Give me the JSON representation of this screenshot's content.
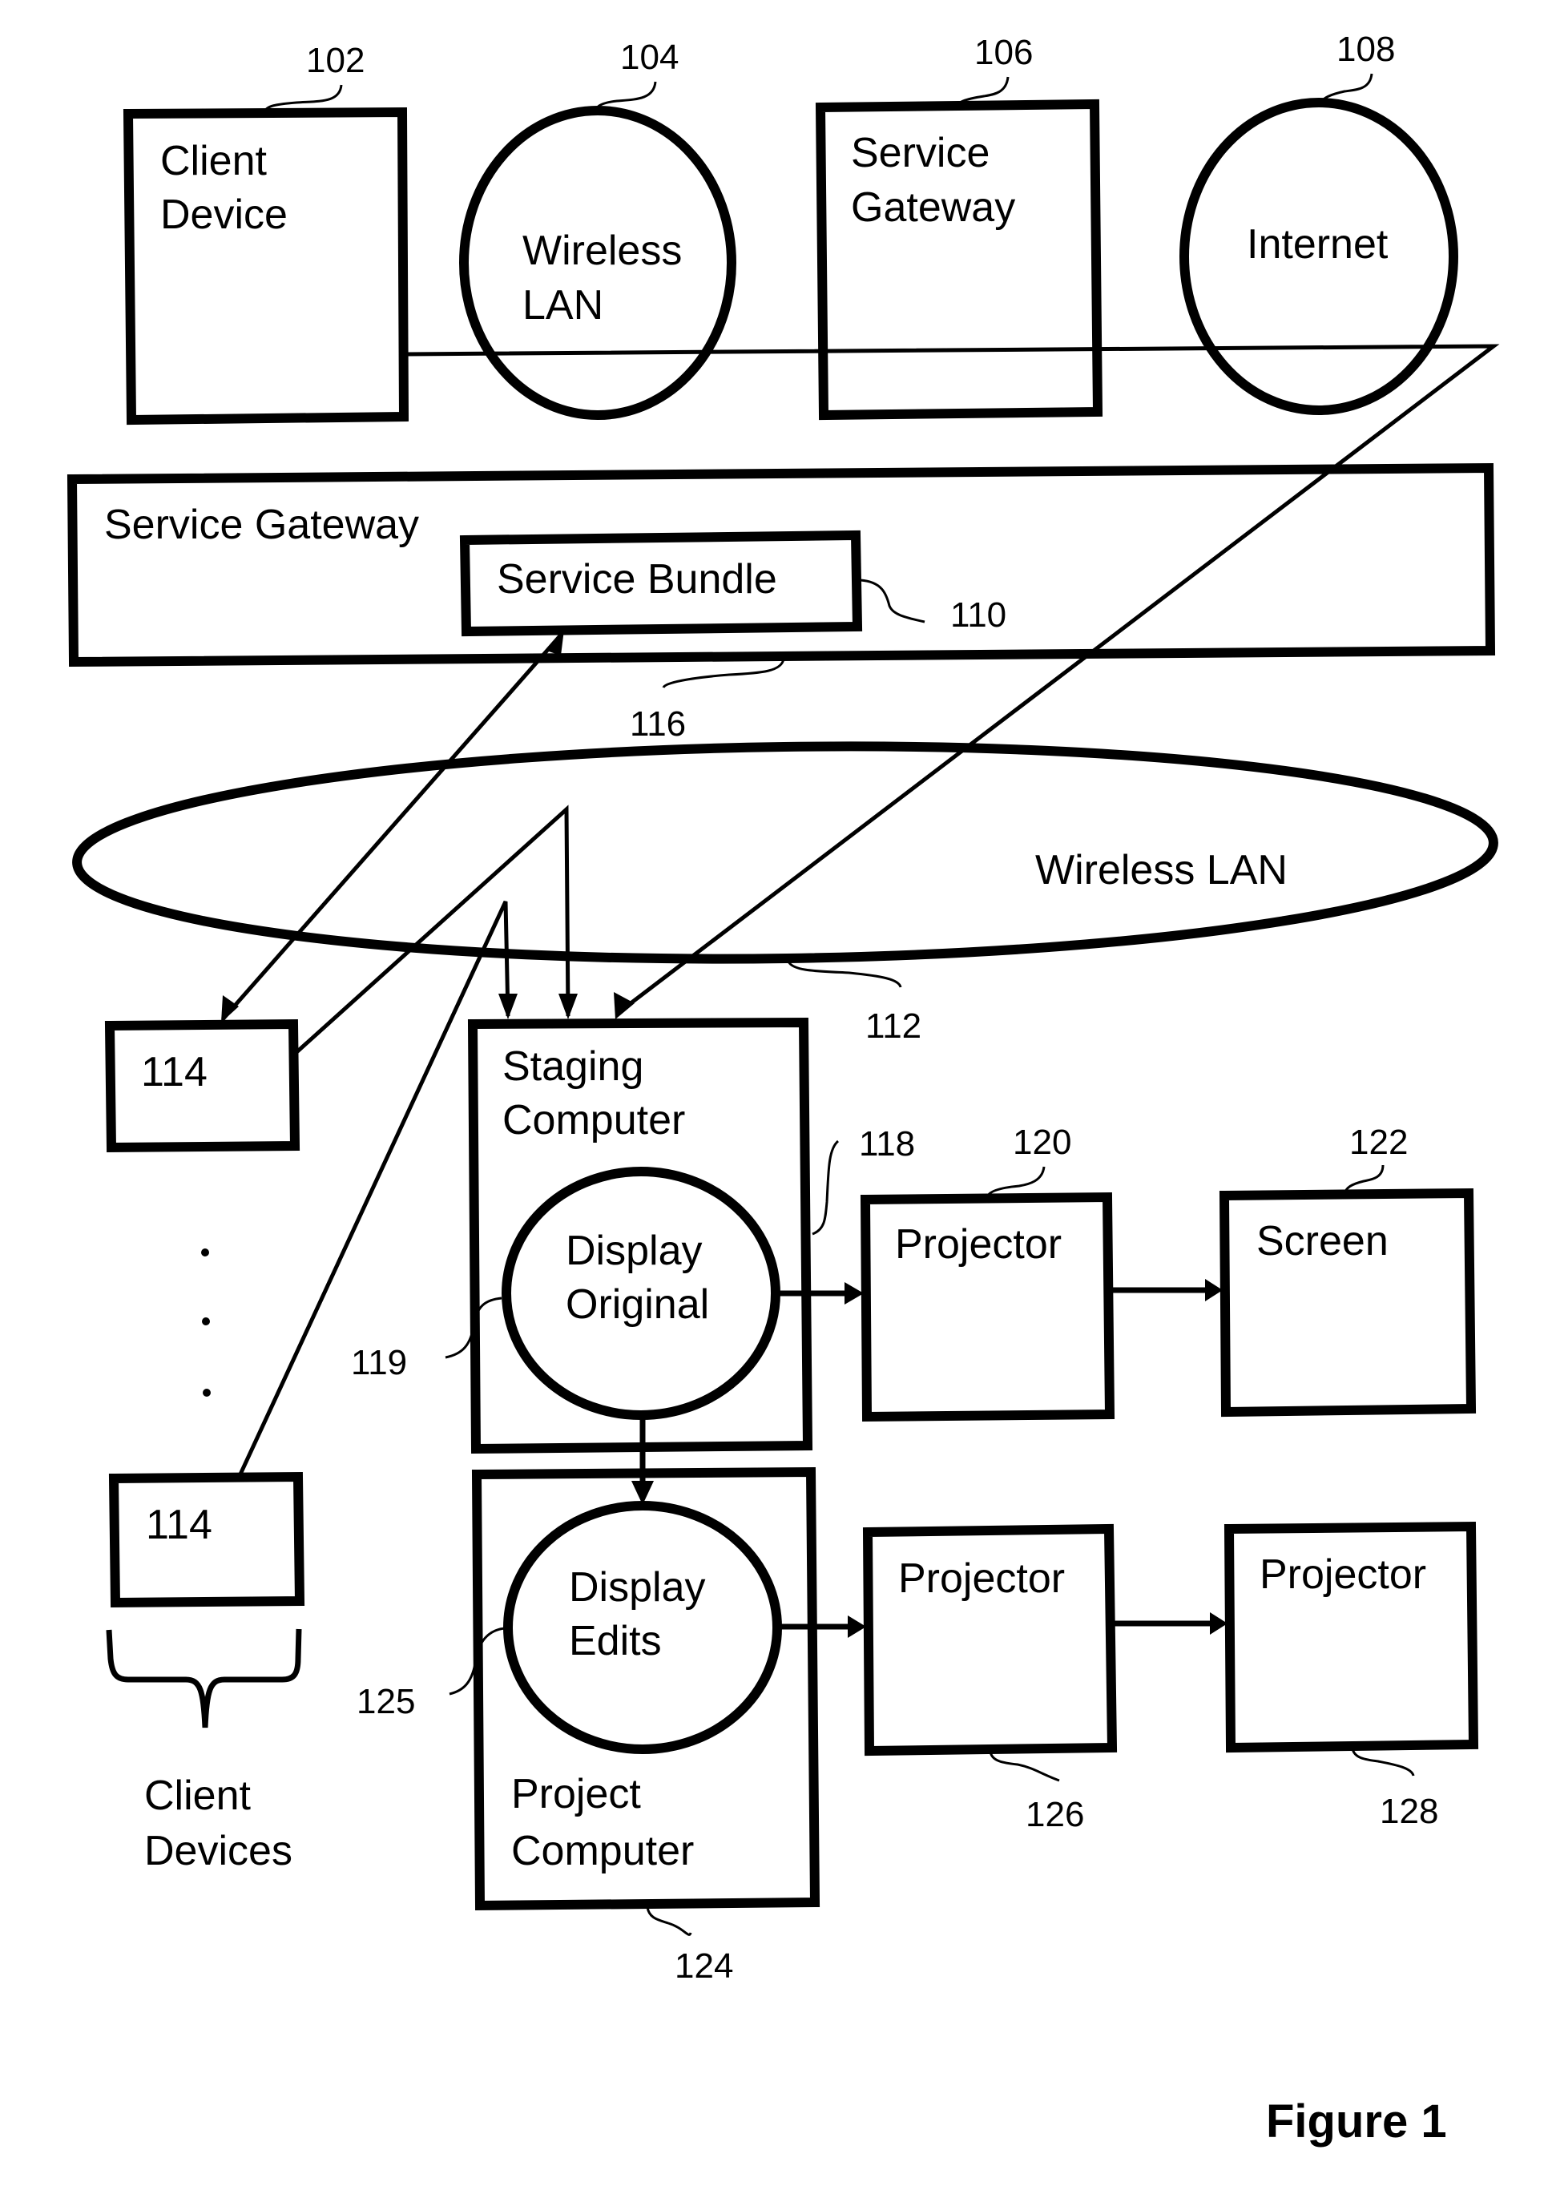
{
  "figure": {
    "caption": "Figure 1",
    "background": "#ffffff",
    "ink": "#000000"
  },
  "nodes": {
    "client_device": {
      "ref": "102",
      "lines": [
        "Client",
        "Device"
      ]
    },
    "wireless_lan_top": {
      "ref": "104",
      "lines": [
        "Wireless",
        "LAN"
      ]
    },
    "service_gateway_top": {
      "ref": "106",
      "lines": [
        "Service",
        "Gateway"
      ]
    },
    "internet": {
      "ref": "108",
      "lines": [
        "Internet"
      ]
    },
    "service_gateway": {
      "ref": "116",
      "label": "Service Gateway"
    },
    "service_bundle": {
      "ref": "110",
      "label": "Service Bundle"
    },
    "wireless_lan": {
      "ref": "112",
      "label": "Wireless LAN"
    },
    "client_114_a": {
      "label": "114"
    },
    "client_114_b": {
      "label": "114"
    },
    "client_devices": {
      "lines": [
        "Client",
        "Devices"
      ]
    },
    "staging_computer": {
      "ref": "118",
      "lines": [
        "Staging",
        "Computer"
      ]
    },
    "display_original": {
      "ref": "119",
      "lines": [
        "Display",
        "Original"
      ]
    },
    "projector_120": {
      "ref": "120",
      "label": "Projector"
    },
    "screen_122": {
      "ref": "122",
      "label": "Screen"
    },
    "project_computer": {
      "ref": "124",
      "lines": [
        "Project",
        "Computer"
      ]
    },
    "display_edits": {
      "ref": "125",
      "lines": [
        "Display",
        "Edits"
      ]
    },
    "projector_126": {
      "ref": "126",
      "label": "Projector"
    },
    "projector_128": {
      "ref": "128",
      "label": "Projector"
    }
  },
  "ellipsis": "..."
}
